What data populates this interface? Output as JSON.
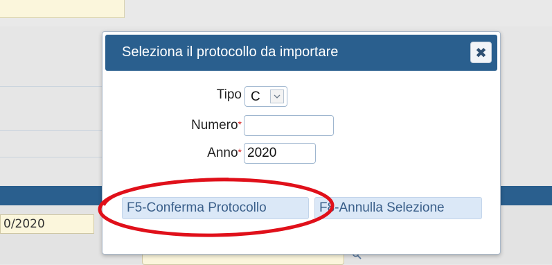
{
  "background": {
    "date_fragment": "0/2020"
  },
  "modal": {
    "title": "Seleziona il protocollo da importare",
    "close_icon": "close-x-icon",
    "fields": {
      "tipo": {
        "label": "Tipo",
        "value": "C"
      },
      "numero": {
        "label": "Numero",
        "required_mark": "*",
        "value": ""
      },
      "anno": {
        "label": "Anno",
        "required_mark": "*",
        "value": "2020"
      }
    },
    "buttons": {
      "confirm": "F5-Conferma Protocollo",
      "cancel": "F8-Annulla Selezione"
    }
  },
  "colors": {
    "header": "#2a5f8e",
    "button_bg": "#dbe8f7",
    "required": "#d42020",
    "annotation": "#e0101a"
  }
}
